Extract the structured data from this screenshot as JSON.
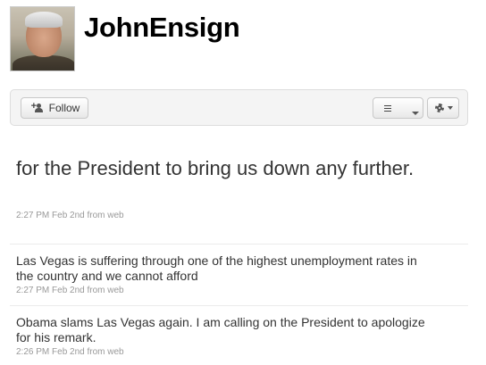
{
  "profile": {
    "screen_name": "JohnEnsign"
  },
  "actions": {
    "follow_label": "Follow",
    "list_icon": "list-icon",
    "gear_icon": "gear-icon"
  },
  "featured_tweet": {
    "text": "for the President to bring us down any further.",
    "time": "2:27 PM Feb 2nd",
    "source": "from web"
  },
  "timeline": [
    {
      "text": "Las Vegas is suffering through one of the highest unemployment rates in the country and we cannot afford",
      "time": "2:27 PM Feb 2nd",
      "source": "from web"
    },
    {
      "text": "Obama slams Las Vegas again. I am calling on the President to apologize for his remark.",
      "time": "2:26 PM Feb 2nd",
      "source": "from web"
    }
  ]
}
